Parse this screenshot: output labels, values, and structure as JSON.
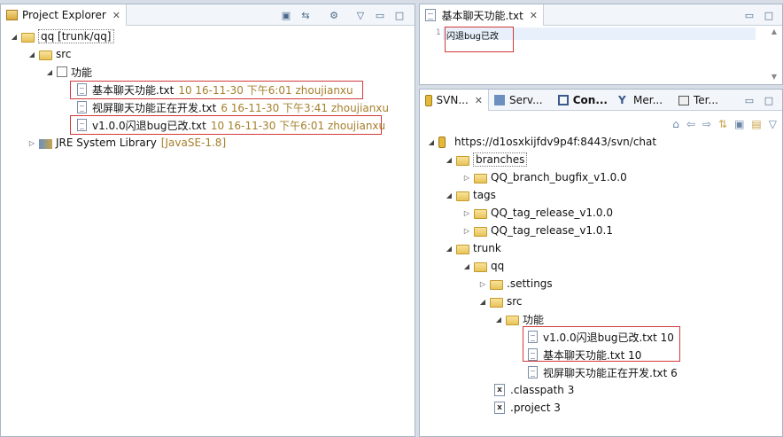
{
  "left": {
    "tab": "Project Explorer",
    "tree": {
      "project": "qq [trunk/qq]",
      "src": "src",
      "pkg": "功能",
      "files": [
        {
          "name": "基本聊天功能.txt",
          "meta": "10  16-11-30 下午6:01  zhoujianxu"
        },
        {
          "name": "视屏聊天功能正在开发.txt",
          "meta": "6  16-11-30 下午3:41  zhoujianxu"
        },
        {
          "name": "v1.0.0闪退bug已改.txt",
          "meta": "10  16-11-30 下午6:01  zhoujianxu"
        }
      ],
      "jre": "JRE System Library",
      "jre_meta": "[JavaSE-1.8]"
    }
  },
  "editor": {
    "tab": "基本聊天功能.txt",
    "line_no": "1",
    "content": "闪退bug已改"
  },
  "svn": {
    "tabs": [
      "SVN...",
      "Serv...",
      "Con...",
      "Mer...",
      "Ter..."
    ],
    "repo": "https://d1osxkijfdv9p4f:8443/svn/chat",
    "branches": "branches",
    "branch_item": "QQ_branch_bugfix_v1.0.0",
    "tags": "tags",
    "tag1": "QQ_tag_release_v1.0.0",
    "tag2": "QQ_tag_release_v1.0.1",
    "trunk": "trunk",
    "qq": "qq",
    "settings": ".settings",
    "src": "src",
    "pkg": "功能",
    "f1": "v1.0.0闪退bug已改.txt 10",
    "f2": "基本聊天功能.txt 10",
    "f3": "视屏聊天功能正在开发.txt 6",
    "classpath": ".classpath 3",
    "project": ".project 3"
  }
}
